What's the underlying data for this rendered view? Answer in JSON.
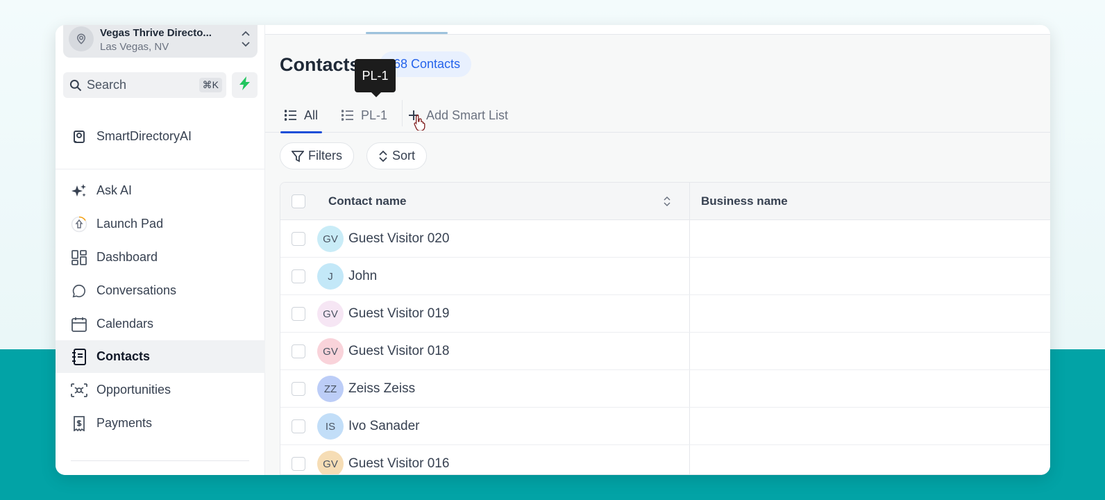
{
  "location": {
    "name": "Vegas Thrive Directo...",
    "city": "Las Vegas, NV"
  },
  "search": {
    "label": "Search",
    "shortcut": "⌘K"
  },
  "sidebar": {
    "pinned": {
      "label": "SmartDirectoryAI",
      "icon": "book-icon"
    },
    "items": [
      {
        "label": "Ask AI",
        "icon": "sparkle-icon"
      },
      {
        "label": "Launch Pad",
        "icon": "rocket-icon"
      },
      {
        "label": "Dashboard",
        "icon": "dashboard-icon"
      },
      {
        "label": "Conversations",
        "icon": "chat-bubble-icon"
      },
      {
        "label": "Calendars",
        "icon": "calendar-icon"
      },
      {
        "label": "Contacts",
        "icon": "contact-book-icon",
        "active": true
      },
      {
        "label": "Opportunities",
        "icon": "opportunities-icon"
      },
      {
        "label": "Payments",
        "icon": "receipt-icon"
      }
    ]
  },
  "main": {
    "title": "Contacts",
    "count_label": "68 Contacts",
    "tooltip": "PL-1",
    "tabs": [
      {
        "label": "All",
        "active": true
      },
      {
        "label": "PL-1"
      }
    ],
    "add_smart_list": "Add Smart List",
    "filters_label": "Filters",
    "sort_label": "Sort"
  },
  "table": {
    "columns": [
      "Contact name",
      "Business name"
    ],
    "rows": [
      {
        "initials": "GV",
        "name": "Guest Visitor 020",
        "avatar_color": "#c9ecf7"
      },
      {
        "initials": "J",
        "name": "John",
        "avatar_color": "#c3e8f8"
      },
      {
        "initials": "GV",
        "name": "Guest Visitor 019",
        "avatar_color": "#f6e6f4"
      },
      {
        "initials": "GV",
        "name": "Guest Visitor 018",
        "avatar_color": "#f9d3da"
      },
      {
        "initials": "ZZ",
        "name": "Zeiss Zeiss",
        "avatar_color": "#bccdf7"
      },
      {
        "initials": "IS",
        "name": "Ivo Sanader",
        "avatar_color": "#c2def8"
      },
      {
        "initials": "GV",
        "name": "Guest Visitor 016",
        "avatar_color": "#f6ddb5"
      }
    ]
  },
  "colors": {
    "accent": "#1d4ed8",
    "bolt": "#22c55e",
    "teal_band": "#02a3a6"
  }
}
